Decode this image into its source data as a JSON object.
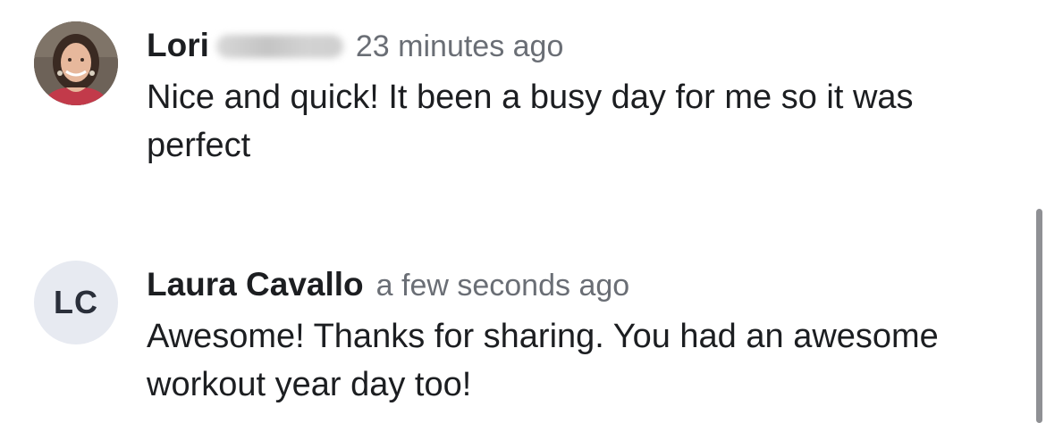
{
  "comments": [
    {
      "author": "Lori",
      "author_surname_hidden": true,
      "timestamp": "23 minutes ago",
      "text": "Nice and quick! It been a busy day for me so it was perfect",
      "avatar": {
        "type": "photo",
        "icon": "user-photo"
      }
    },
    {
      "author": "Laura Cavallo",
      "timestamp": "a few seconds ago",
      "text": "Awesome! Thanks for sharing. You had an awesome workout year day too!",
      "avatar": {
        "type": "initials",
        "initials": "LC",
        "background": "#e7eaf1"
      }
    }
  ],
  "colors": {
    "text": "#1c1e21",
    "timestamp": "#6a6e75",
    "scrollbar": "#8f9094"
  }
}
